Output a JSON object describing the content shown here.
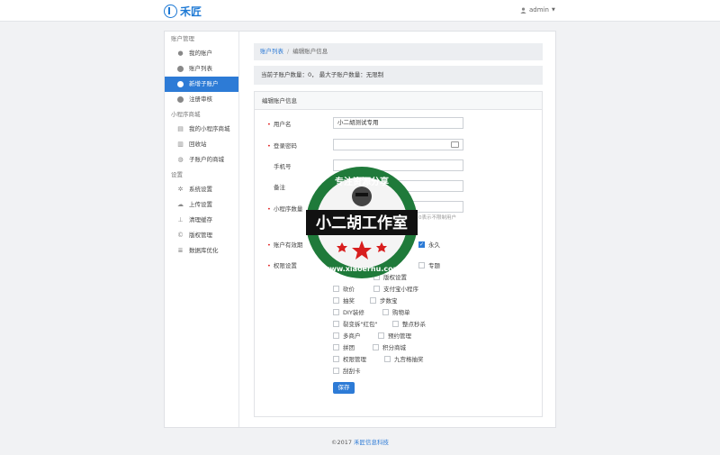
{
  "header": {
    "logo_text": "禾匠",
    "user": "admin"
  },
  "sidebar": {
    "groups": [
      {
        "title": "账户管理",
        "items": [
          {
            "label": "我的账户",
            "icon": "user-icon"
          },
          {
            "label": "账户列表",
            "icon": "list-icon"
          },
          {
            "label": "新增子账户",
            "icon": "add-account-icon",
            "active": true
          },
          {
            "label": "注册审核",
            "icon": "review-icon"
          }
        ]
      },
      {
        "title": "小程序商城",
        "items": [
          {
            "label": "我的小程序商城",
            "icon": "shop-icon"
          },
          {
            "label": "回收站",
            "icon": "trash-icon"
          },
          {
            "label": "子账户的商城",
            "icon": "sub-shop-icon"
          }
        ]
      },
      {
        "title": "设置",
        "items": [
          {
            "label": "系统设置",
            "icon": "gear-icon"
          },
          {
            "label": "上传设置",
            "icon": "cloud-upload-icon"
          },
          {
            "label": "清理缓存",
            "icon": "clear-cache-icon"
          },
          {
            "label": "版权管理",
            "icon": "copyright-icon"
          },
          {
            "label": "数据库优化",
            "icon": "database-icon"
          }
        ]
      }
    ]
  },
  "breadcrumb": {
    "link": "账户列表",
    "sep": "/",
    "current": "编辑账户信息"
  },
  "notice": "当前子账户数量：0，  最大子账户数量：无限制",
  "card": {
    "title": "编辑账户信息"
  },
  "form": {
    "username": {
      "label": "用户名",
      "value": "小二胡测试专用"
    },
    "password": {
      "label": "登录密码",
      "value": ""
    },
    "phone": {
      "label": "手机号",
      "value": ""
    },
    "remark": {
      "label": "备注",
      "value": ""
    },
    "miniapp_count": {
      "label": "小程序数量",
      "value": "",
      "hint": "0表示不限制用户"
    },
    "validity": {
      "label": "账户有效期",
      "forever": "永久"
    },
    "permissions": {
      "label": "权限设置",
      "items": [
        "专题",
        "版权设置",
        "砍价",
        "支付宝小程序",
        "抽奖",
        "步数宝",
        "DIY装修",
        "购物单",
        "裂变拆\"红包\"",
        "整点秒杀",
        "多商户",
        "预约管理",
        "拼团",
        "积分商城",
        "权限管理",
        "九宫格抽奖",
        "刮刮卡"
      ]
    },
    "save_label": "保存"
  },
  "footer": {
    "prefix": "©2017 ",
    "company": "禾匠信息科技"
  },
  "watermark": {
    "top": "专注资源分享",
    "main": "小二胡工作室",
    "url": "www.xiaoerhu.com"
  },
  "colors": {
    "accent": "#2d7bd6",
    "active_bg": "#2d7bd6",
    "required": "#e02020"
  }
}
